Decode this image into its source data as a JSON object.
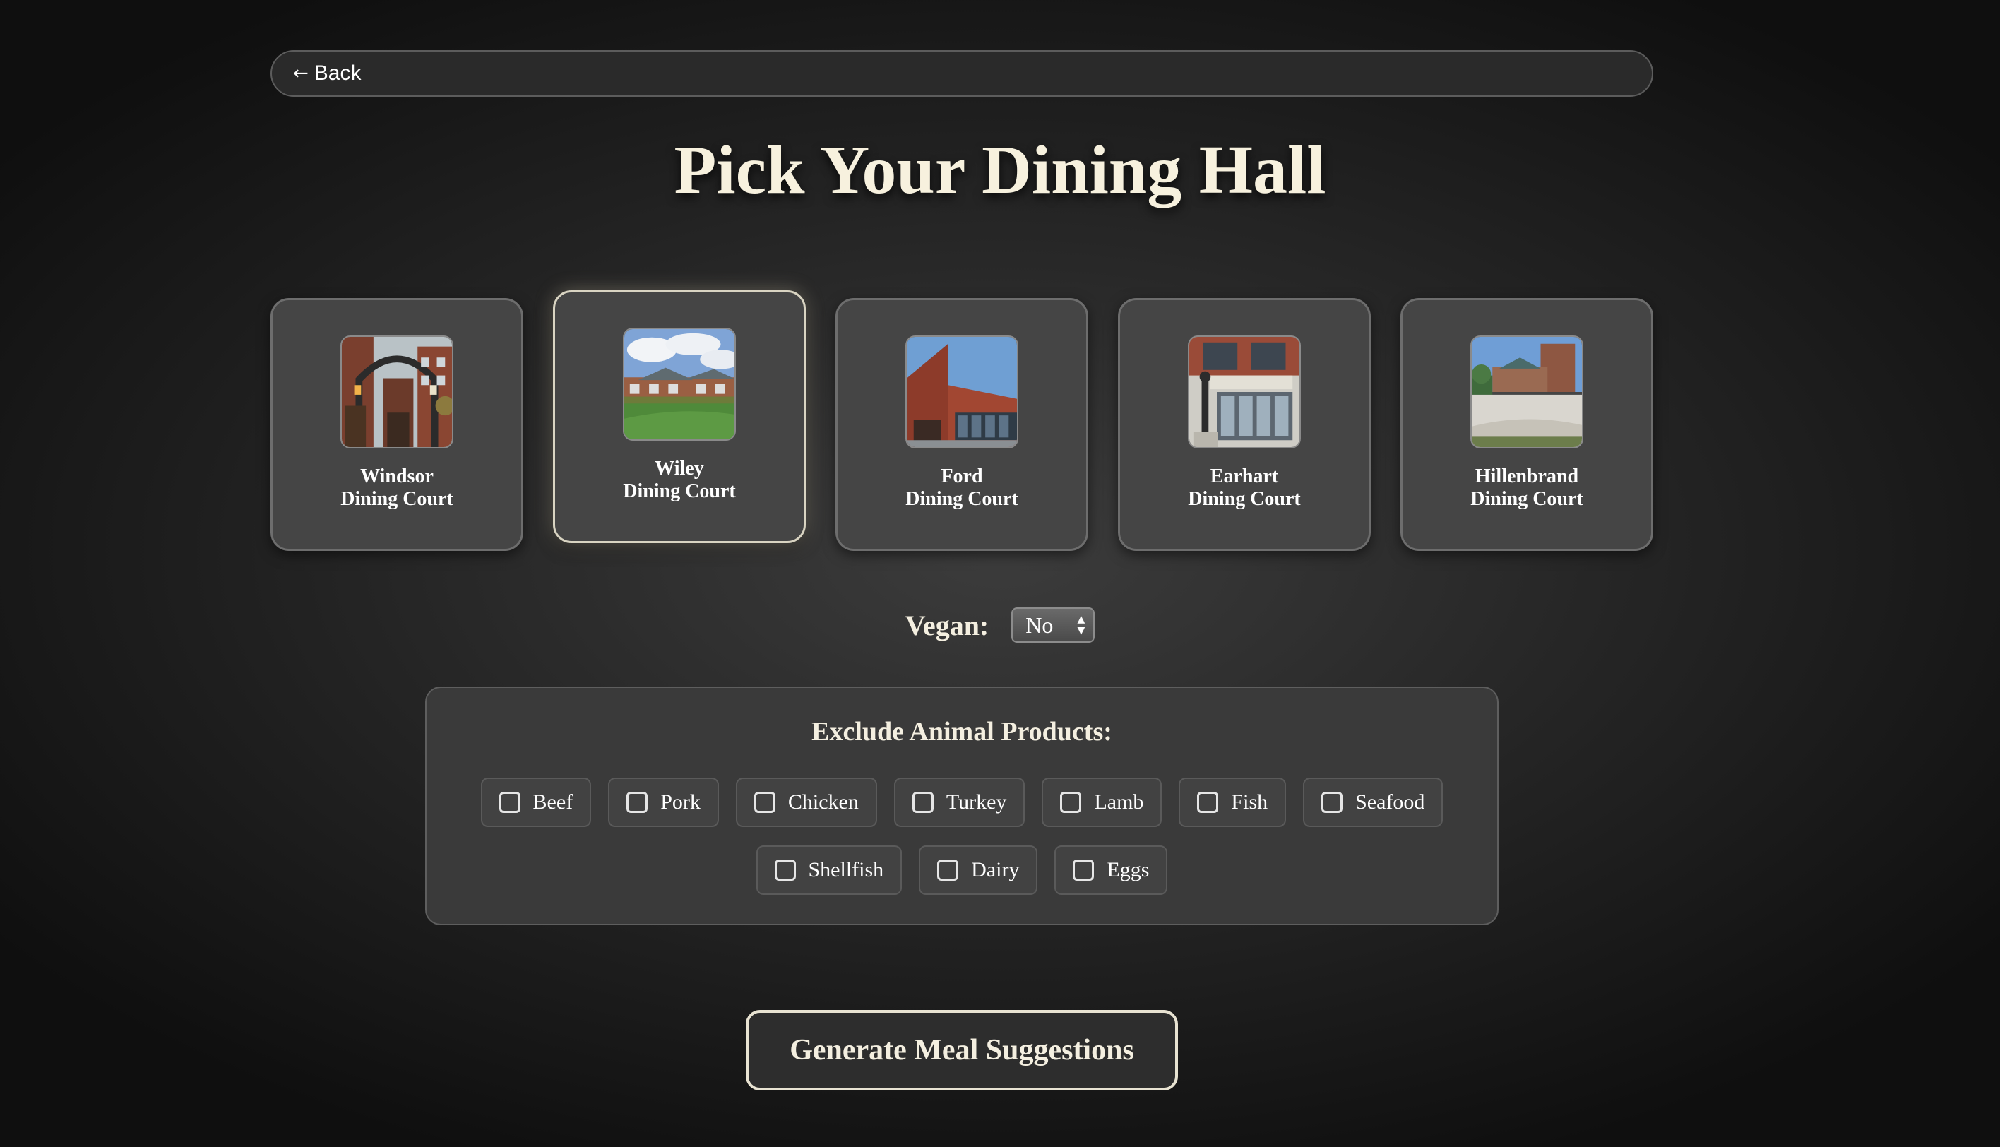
{
  "header": {
    "back_icon": "arrow-left-icon",
    "back_label": "Back"
  },
  "page": {
    "title": "Pick Your Dining Hall"
  },
  "halls": [
    {
      "line1": "Windsor",
      "line2": "Dining Court",
      "selected": false
    },
    {
      "line1": "Wiley",
      "line2": "Dining Court",
      "selected": true
    },
    {
      "line1": "Ford",
      "line2": "Dining Court",
      "selected": false
    },
    {
      "line1": "Earhart",
      "line2": "Dining Court",
      "selected": false
    },
    {
      "line1": "Hillenbrand",
      "line2": "Dining Court",
      "selected": false
    }
  ],
  "vegan": {
    "label": "Vegan:",
    "value": "No",
    "arrows_icon": "select-arrows-icon"
  },
  "exclude": {
    "title": "Exclude Animal Products:",
    "options": [
      {
        "label": "Beef",
        "checked": false
      },
      {
        "label": "Pork",
        "checked": false
      },
      {
        "label": "Chicken",
        "checked": false
      },
      {
        "label": "Turkey",
        "checked": false
      },
      {
        "label": "Lamb",
        "checked": false
      },
      {
        "label": "Fish",
        "checked": false
      },
      {
        "label": "Seafood",
        "checked": false
      },
      {
        "label": "Shellfish",
        "checked": false
      },
      {
        "label": "Dairy",
        "checked": false
      },
      {
        "label": "Eggs",
        "checked": false
      }
    ]
  },
  "actions": {
    "generate_label": "Generate Meal Suggestions"
  },
  "colors": {
    "title": "#f7f1de",
    "card_border": "#6d6d6d",
    "selected_border": "#d9d4c2",
    "button_border": "#e8e3d2"
  }
}
